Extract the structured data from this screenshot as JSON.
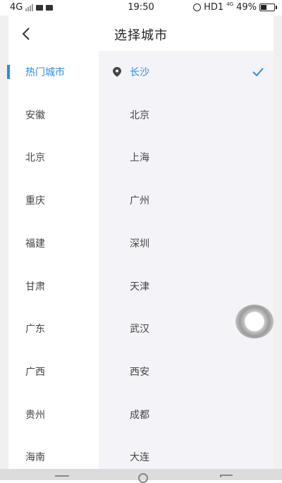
{
  "status_bar": {
    "network": "4G",
    "time": "19:50",
    "hd_label": "HD1",
    "net_small": "4G",
    "battery": "49%",
    "battery_level": 0.49
  },
  "header": {
    "title": "选择城市",
    "back_icon": "chevron-left-icon"
  },
  "provinces": [
    {
      "label": "热门城市",
      "active": true
    },
    {
      "label": "安徽"
    },
    {
      "label": "北京"
    },
    {
      "label": "重庆"
    },
    {
      "label": "福建"
    },
    {
      "label": "甘肃"
    },
    {
      "label": "广东"
    },
    {
      "label": "广西"
    },
    {
      "label": "贵州"
    },
    {
      "label": "海南"
    }
  ],
  "cities": [
    {
      "label": "长沙",
      "current": true,
      "selected": true
    },
    {
      "label": "北京"
    },
    {
      "label": "上海"
    },
    {
      "label": "广州"
    },
    {
      "label": "深圳"
    },
    {
      "label": "天津"
    },
    {
      "label": "武汉"
    },
    {
      "label": "西安"
    },
    {
      "label": "成都"
    },
    {
      "label": "大连"
    }
  ],
  "colors": {
    "accent": "#2a8ce0",
    "right_pane_bg": "#f4f4f8"
  },
  "icons": {
    "location": "location-pin-icon",
    "selected": "checkmark-icon",
    "floating": "assistive-touch-icon"
  }
}
